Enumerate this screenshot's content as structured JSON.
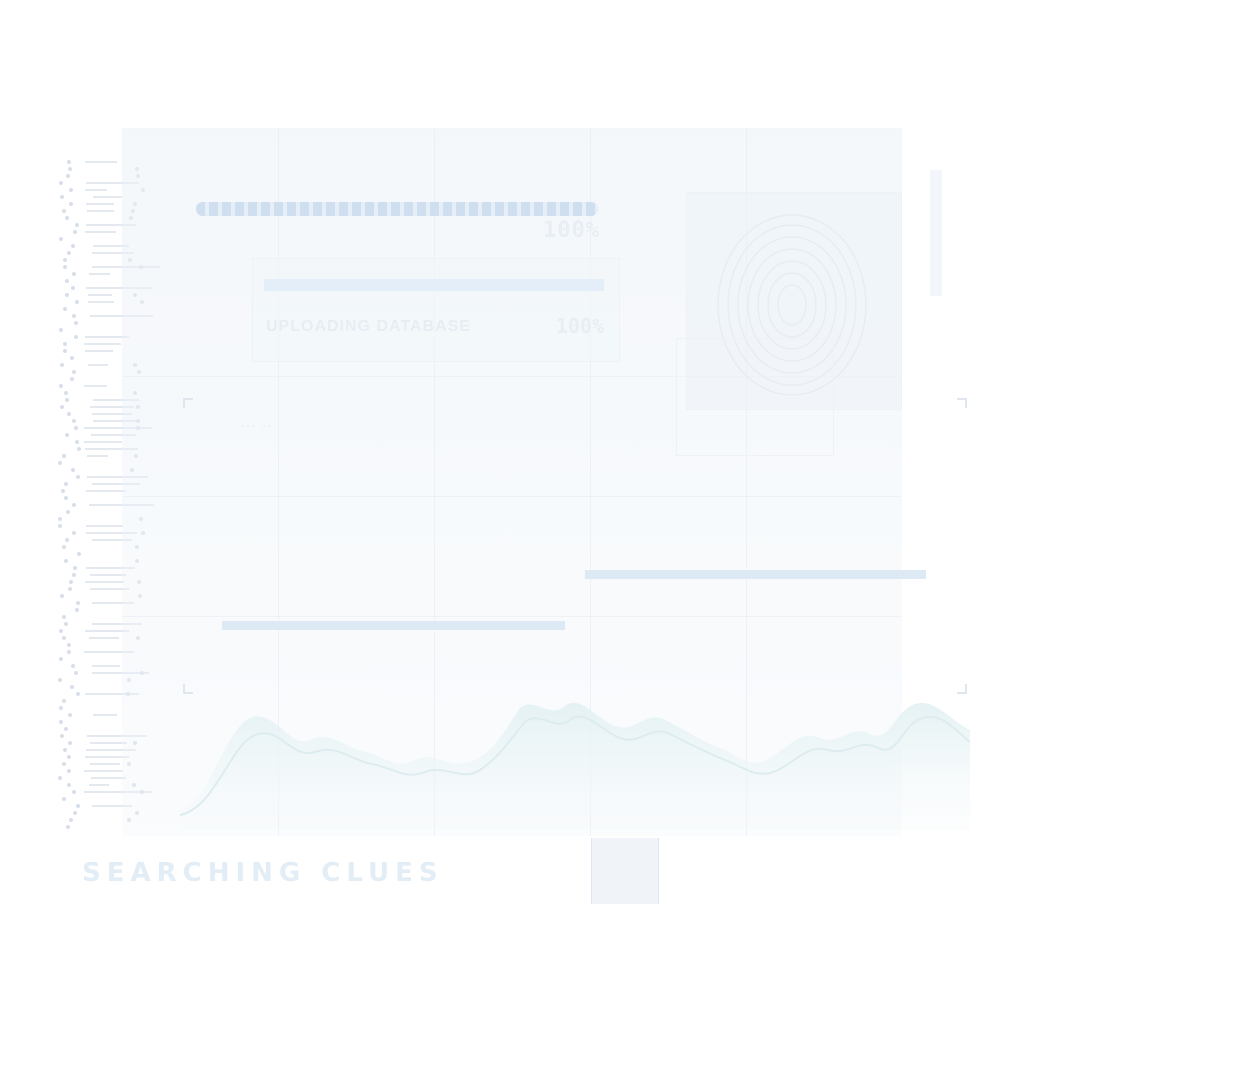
{
  "top_progress": {
    "percent_label": "100%",
    "value": 1.0
  },
  "upload": {
    "label": "UPLOADING DATABASE",
    "percent_label": "100%",
    "value": 1.0
  },
  "analysis_label": "... ..",
  "footer": {
    "status": "SEARCHING CLUES"
  },
  "colors": {
    "background": "#ffffff",
    "accent": "#dde9f5",
    "wave": "#e5f1f3"
  },
  "icons": [
    "fingerprint-icon"
  ]
}
